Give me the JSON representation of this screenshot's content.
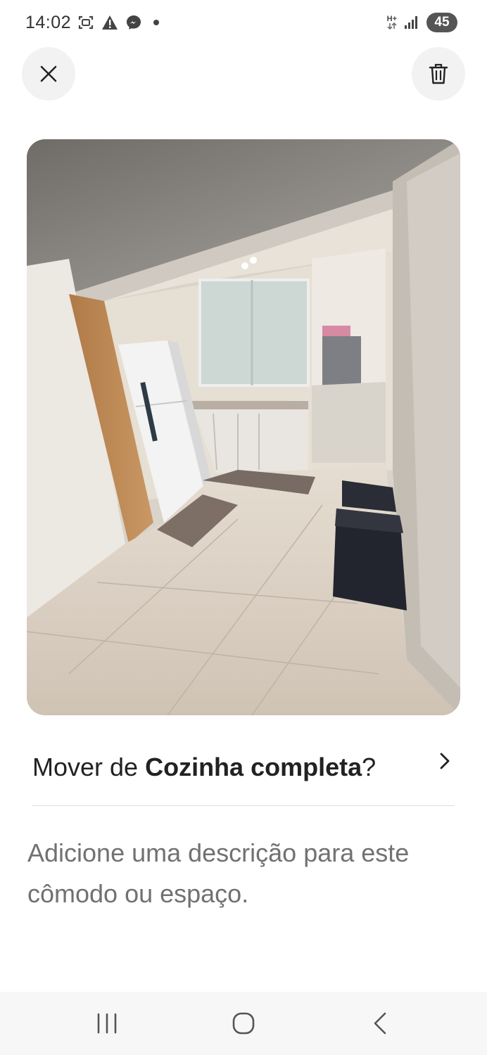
{
  "status_bar": {
    "time": "14:02",
    "net_type_top": "H+",
    "battery": "45",
    "icons": [
      "screenshot-icon",
      "warning-icon",
      "messenger-icon",
      "dot-icon",
      "network-icon",
      "signal-icon"
    ]
  },
  "header": {
    "close_icon": "close-icon",
    "delete_icon": "trash-icon"
  },
  "photo": {
    "subject": "kitchen-photo"
  },
  "move": {
    "prefix": "Mover de ",
    "room": "Cozinha completa",
    "suffix": "?"
  },
  "description_placeholder": "Adicione uma descrição para este cômodo ou espaço.",
  "nav": {
    "icons": [
      "recents-icon",
      "home-icon",
      "back-icon"
    ]
  }
}
